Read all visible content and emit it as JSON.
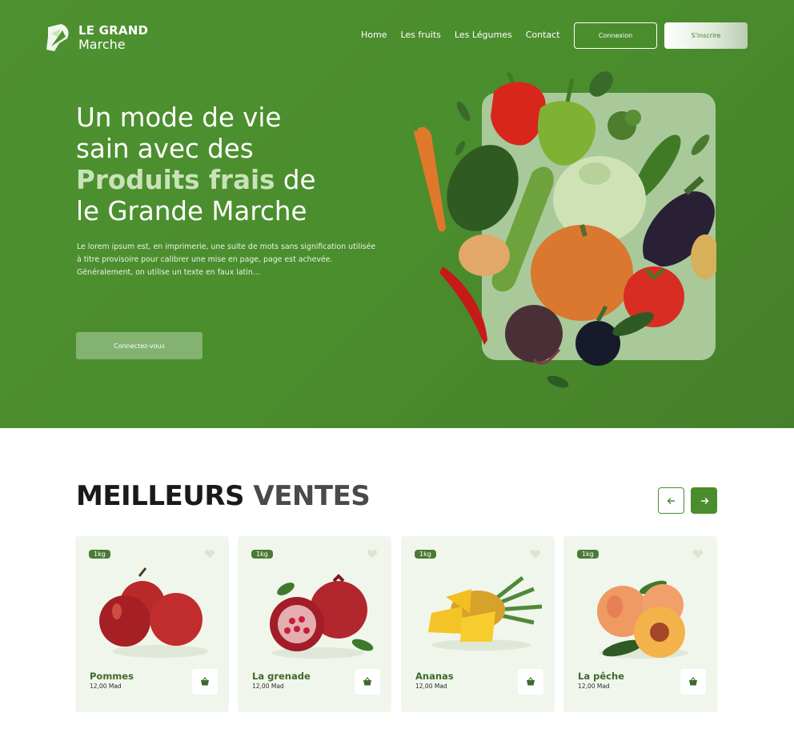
{
  "header": {
    "logo_line1": "LE GRAND",
    "logo_line2": "Marche",
    "nav": [
      "Home",
      "Les fruits",
      "Les Légumes",
      "Contact"
    ],
    "login_label": "Connexion",
    "signup_label": "S'inscrire"
  },
  "hero": {
    "title_part1": "Un mode de vie",
    "title_part2": "sain avec des",
    "title_highlight": "Produits frais",
    "title_part3": " de",
    "title_part4": "le Grande Marche",
    "description": "Le lorem ipsum est, en imprimerie, une suite de mots sans signification utilisée à titre provisoire pour calibrer une mise en page, page est achevée. Généralement, on utilise un texte en faux latin...",
    "cta_label": "Connectez-vous"
  },
  "best_sellers": {
    "title_dark": "MEILLEURS",
    "title_light": " VENTES",
    "prev_icon": "arrow-left-icon",
    "next_icon": "arrow-right-icon",
    "products": [
      {
        "badge": "1kg",
        "name": "Pommes",
        "price": "12,00 Mad",
        "image": "apples"
      },
      {
        "badge": "1kg",
        "name": "La grenade",
        "price": "12,00 Mad",
        "image": "pomegranate"
      },
      {
        "badge": "1kg",
        "name": "Ananas",
        "price": "12,00 Mad",
        "image": "pineapple"
      },
      {
        "badge": "1kg",
        "name": "La pêche",
        "price": "12,00 Mad",
        "image": "peach"
      }
    ]
  },
  "colors": {
    "brand_green": "#4a8d2d",
    "dark_green": "#4a7a35",
    "card_bg": "#f1f6ec",
    "highlight_green": "#c9e2b8"
  }
}
